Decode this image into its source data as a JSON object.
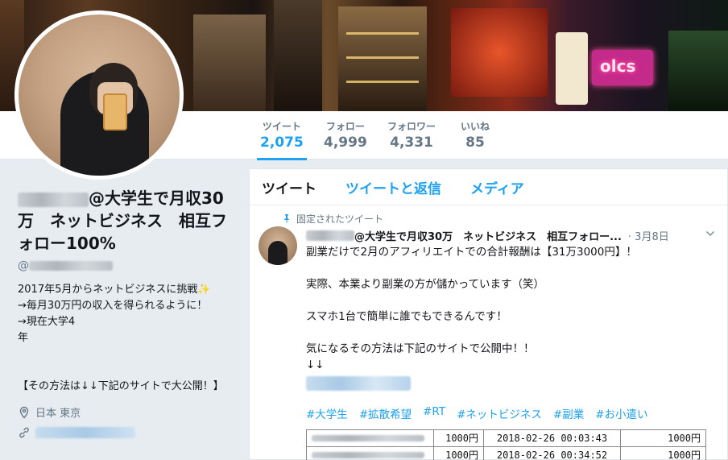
{
  "banner": {
    "neon_sign": "olcs"
  },
  "stats": [
    {
      "label": "ツイート",
      "value": "2,075",
      "active": true
    },
    {
      "label": "フォロー",
      "value": "4,999",
      "active": false
    },
    {
      "label": "フォロワー",
      "value": "4,331",
      "active": false
    },
    {
      "label": "いいね",
      "value": "85",
      "active": false
    }
  ],
  "profile": {
    "name_suffix": "@大学生で月収30万　ネットビジネス　相互フォロー100%",
    "handle_prefix": "@",
    "bio": "2017年5月からネットビジネスに挑戦✨\n→毎月30万円の収入を得られるように！\n→現在大学4\n年\n\n\n【その方法は↓↓下記のサイトで大公開！】",
    "location": "日本 東京"
  },
  "timeline": {
    "tabs": [
      "ツイート",
      "ツイートと返信",
      "メディア"
    ]
  },
  "tweet": {
    "pinned_label": "固定されたツイート",
    "name_suffix": "@大学生で月収30万　ネットビジネス　相互フォロー...",
    "date": "· 3月8日",
    "body": "副業だけで2月のアフィリエイトでの合計報酬は【31万3000円】！\n\n実際、本業より副業の方が儲かっています（笑）\n\nスマホ1台で簡単に誰でもできるんです！\n\n気になるその方法は下記のサイトで公開中！！\n↓↓",
    "hashtags": [
      "#大学生",
      "#拡散希望",
      "#RT",
      "#ネットビジネス",
      "#副業",
      "#お小遣い"
    ],
    "rows": [
      {
        "amount": "1000円",
        "date": "2018-02-26 00:03:43",
        "amount2": "1000円"
      },
      {
        "amount": "1000円",
        "date": "2018-02-26 00:34:52",
        "amount2": "1000円"
      }
    ]
  }
}
